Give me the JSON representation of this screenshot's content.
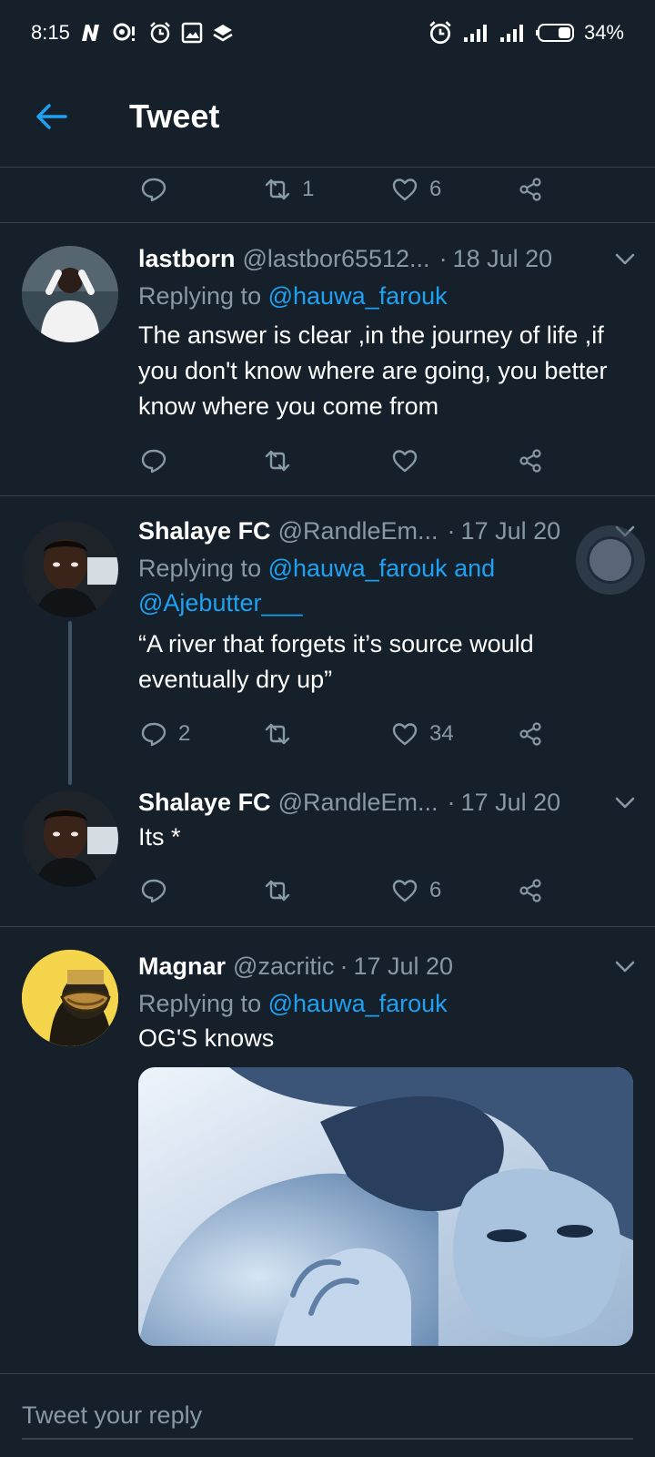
{
  "status_bar": {
    "time": "8:15",
    "battery": "34%",
    "left_icons": [
      "n-icon",
      "chat-icon",
      "alarm-icon",
      "image-icon",
      "layers-icon"
    ],
    "right_icons": [
      "alarm-icon",
      "signal-icon",
      "signal-icon",
      "battery-icon"
    ]
  },
  "header": {
    "title": "Tweet",
    "back_icon": "back-arrow-icon"
  },
  "accent_color": "#1da1f2",
  "top_actions": {
    "retweets": "1",
    "likes": "6"
  },
  "tweets": [
    {
      "name": "lastborn",
      "handle": "@lastbor65512...",
      "date": "18 Jul 20",
      "replying_label": "Replying to",
      "mentions": "@hauwa_farouk",
      "text": "The answer is clear ,in the journey of life ,if you don't know where are going, you better know where you come from",
      "replies": "",
      "retweets": "",
      "likes": ""
    },
    {
      "name": "Shalaye FC",
      "handle": "@RandleEm...",
      "date": "17 Jul 20",
      "replying_label": "Replying to",
      "mentions": "@hauwa_farouk and @Ajebutter___",
      "text": "“A river that forgets it’s source would eventually dry up”",
      "replies": "2",
      "retweets": "",
      "likes": "34"
    },
    {
      "name": "Shalaye FC",
      "handle": "@RandleEm...",
      "date": "17 Jul 20",
      "text": "Its *",
      "replies": "",
      "retweets": "",
      "likes": "6"
    },
    {
      "name": "Magnar",
      "handle": "@zacritic",
      "date": "17 Jul 20",
      "replying_label": "Replying to",
      "mentions": "@hauwa_farouk",
      "text": "OG'S knows"
    }
  ],
  "compose": {
    "placeholder": "Tweet your reply"
  }
}
